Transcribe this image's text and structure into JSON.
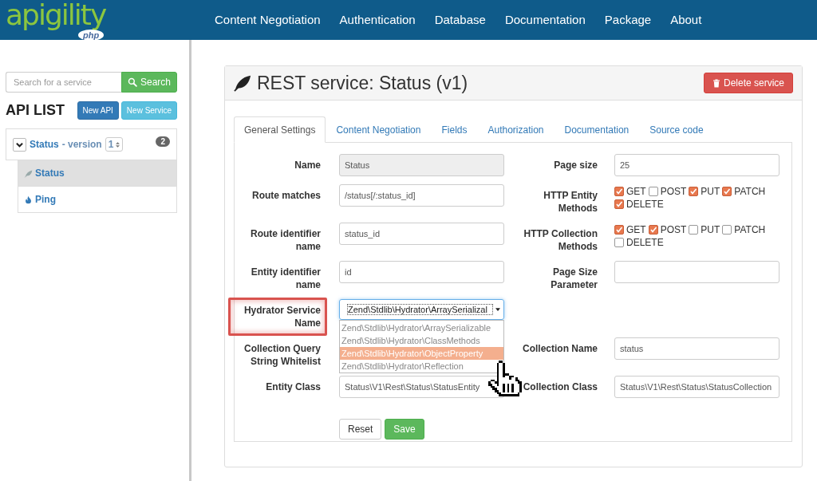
{
  "brand": {
    "logo": "apigility",
    "badge": "php"
  },
  "nav": [
    "Content Negotiation",
    "Authentication",
    "Database",
    "Documentation",
    "Package",
    "About"
  ],
  "sidebar": {
    "search": {
      "placeholder": "Search for a service",
      "button": "Search"
    },
    "title": "API LIST",
    "buttons": [
      {
        "label": "New API",
        "kind": "primary"
      },
      {
        "label": "New Service",
        "kind": "info"
      }
    ],
    "api": {
      "name": "Status",
      "version_label": "- version",
      "version": "1",
      "count": "2",
      "expanded": true,
      "services": [
        {
          "name": "Status",
          "kind": "rest",
          "selected": true
        },
        {
          "name": "Ping",
          "kind": "rpc",
          "selected": false
        }
      ]
    }
  },
  "panel": {
    "title": "REST service: Status (v1)",
    "delete_button": "Delete service",
    "tabs": [
      {
        "label": "General Settings",
        "selected": true
      },
      {
        "label": "Content Negotiation",
        "selected": false
      },
      {
        "label": "Fields",
        "selected": false
      },
      {
        "label": "Authorization",
        "selected": false
      },
      {
        "label": "Documentation",
        "selected": false
      },
      {
        "label": "Source code",
        "selected": false
      }
    ],
    "rows": [
      {
        "left": {
          "label": "Name",
          "kind": "input",
          "value": "Status",
          "disabled": true
        },
        "right": {
          "label": "Page size",
          "kind": "input",
          "value": "25",
          "disabled": false
        }
      },
      {
        "left": {
          "label": "Route matches",
          "kind": "input",
          "value": "/status[/:status_id]",
          "disabled": false
        },
        "right": {
          "label": "HTTP Entity Methods",
          "kind": "checkboxes",
          "options": [
            {
              "label": "GET",
              "checked": true
            },
            {
              "label": "POST",
              "checked": false
            },
            {
              "label": "PUT",
              "checked": true
            },
            {
              "label": "PATCH",
              "checked": true
            },
            {
              "label": "DELETE",
              "checked": true
            }
          ]
        }
      },
      {
        "left": {
          "label": "Route identifier name",
          "kind": "input",
          "value": "status_id",
          "disabled": false
        },
        "right": {
          "label": "HTTP Collection Methods",
          "kind": "checkboxes",
          "options": [
            {
              "label": "GET",
              "checked": true
            },
            {
              "label": "POST",
              "checked": true
            },
            {
              "label": "PUT",
              "checked": false
            },
            {
              "label": "PATCH",
              "checked": false
            },
            {
              "label": "DELETE",
              "checked": false
            }
          ]
        }
      },
      {
        "left": {
          "label": "Entity identifier name",
          "kind": "input",
          "value": "id",
          "disabled": false
        },
        "right": {
          "label": "Page Size Parameter",
          "kind": "input",
          "disabled": false
        }
      },
      {
        "left": {
          "label": "Hydrator Service Name",
          "highlighted": true,
          "kind": "select",
          "value": "Zend\\Stdlib\\Hydrator\\ArraySerializal",
          "expanded": true,
          "options": [
            {
              "label": "Zend\\Stdlib\\Hydrator\\ArraySerializable",
              "selected": false
            },
            {
              "label": "Zend\\Stdlib\\Hydrator\\ClassMethods",
              "selected": false
            },
            {
              "label": "Zend\\Stdlib\\Hydrator\\ObjectProperty",
              "selected": true
            },
            {
              "label": "Zend\\Stdlib\\Hydrator\\Reflection",
              "selected": false
            }
          ]
        }
      },
      {
        "left": {
          "label": "Collection Query String Whitelist",
          "kind": "covered"
        },
        "right": {
          "label": "Collection Name",
          "kind": "input",
          "value": "status",
          "disabled": false
        }
      },
      {
        "left": {
          "label": "Entity Class",
          "kind": "input",
          "value": "Status\\V1\\Rest\\Status\\StatusEntity",
          "disabled": false
        },
        "right": {
          "label": "Collection Class",
          "kind": "input",
          "value": "Status\\V1\\Rest\\Status\\StatusCollection",
          "disabled": false
        }
      }
    ],
    "buttons": [
      {
        "label": "Reset",
        "kind": "default"
      },
      {
        "label": "Save",
        "kind": "success"
      }
    ]
  }
}
